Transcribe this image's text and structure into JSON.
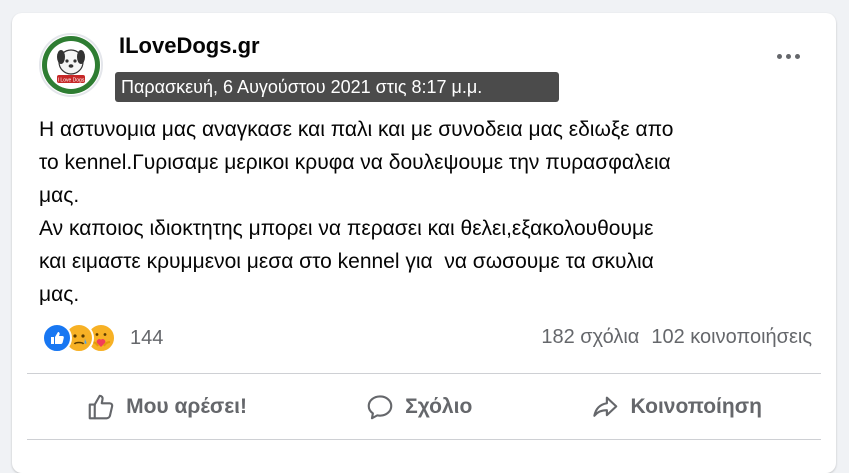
{
  "post": {
    "page_name": "ILoveDogs.gr",
    "timestamp_tooltip": "Παρασκευή, 6 Αυγούστου 2021 στις 8:17 μ.μ.",
    "avatar_icon": "dog-logo-icon",
    "avatar_logo_text": "I Love Dogs",
    "more_icon": "more-options-icon",
    "text": "Η αστυνομια μας αναγκασε και παλι και με συνοδεια μας εδιωξε απο\nτο kennel.Γυρισαμε μερικοι κρυφα να δουλεψουμε την πυρασφαλεια\nμας.\nΑν καποιος ιδιοκτητης μπορει να περασει και θελει,εξακολουθουμε\nκαι ειμαστε κρυμμενοι μεσα στο kennel για  να σωσουμε τα σκυλια\nμας."
  },
  "reactions": {
    "icons": [
      "like-reaction-icon",
      "sad-reaction-icon",
      "care-reaction-icon"
    ],
    "count": "144"
  },
  "stats": {
    "comments": "182 σχόλια",
    "shares": "102 κοινοποιήσεις"
  },
  "actions": {
    "like_label": "Μου αρέσει!",
    "comment_label": "Σχόλιο",
    "share_label": "Κοινοποίηση"
  },
  "colors": {
    "like_blue": "#1877f2",
    "reaction_yellow": "#f7b125",
    "secondary_text": "#65676b",
    "background": "#f0f2f5"
  }
}
